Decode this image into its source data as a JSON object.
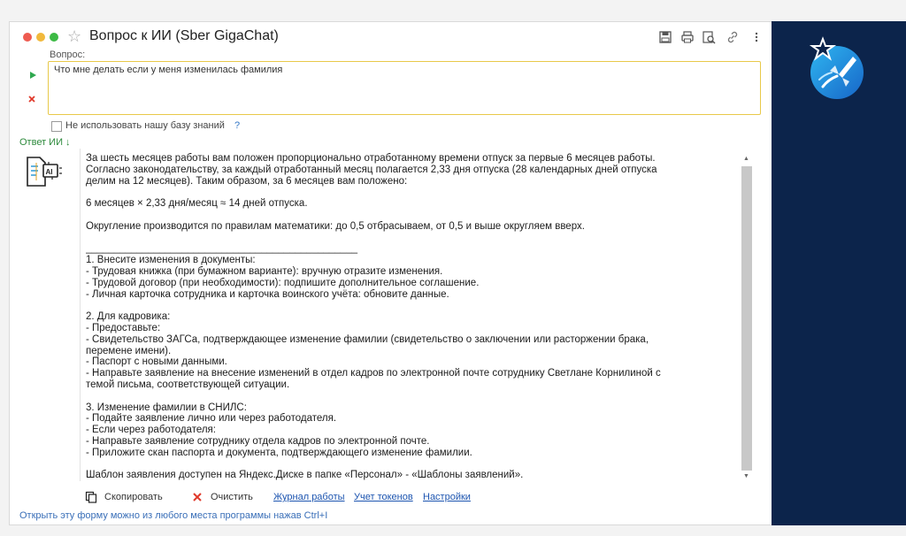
{
  "window": {
    "title": "Вопрос к ИИ (Sber GigaChat)"
  },
  "question": {
    "label": "Вопрос:",
    "value": "Что мне делать если у меня изменилась фамилия"
  },
  "knowledge_base": {
    "label": "Не использовать нашу базу знаний",
    "help": "?"
  },
  "answer": {
    "label": "Ответ ИИ ↓",
    "text": "За шесть месяцев работы вам положен пропорционально отработанному времени отпуск за первые 6 месяцев работы.\nСогласно законодательству, за каждый отработанный месяц полагается 2,33 дня отпуска (28 календарных дней отпуска\nделим на 12 месяцев). Таким образом, за 6 месяцев вам положено:\n\n6 месяцев × 2,33 дня/месяц ≈ 14 дней отпуска.\n\nОкругление производится по правилам математики: до 0,5 отбрасываем, от 0,5 и выше округляем вверх.\n\n________________________________________________\n1. Внесите изменения в документы:\n- Трудовая книжка (при бумажном варианте): вручную отразите изменения.\n- Трудовой договор (при необходимости): подпишите дополнительное соглашение.\n- Личная карточка сотрудника и карточка воинского учёта: обновите данные.\n\n2. Для кадровика:\n- Предоставьте:\n- Свидетельство ЗАГСа, подтверждающее изменение фамилии (свидетельство о заключении или расторжении брака,\nперемене имени).\n- Паспорт с новыми данными.\n- Направьте заявление на внесение изменений в отдел кадров по электронной почте сотруднику Светлане Корнилиной с\nтемой письма, соответствующей ситуации.\n\n3. Изменение фамилии в СНИЛС:\n- Подайте заявление лично или через работодателя.\n- Если через работодателя:\n- Направьте заявление сотруднику отдела кадров по электронной почте.\n- Приложите скан паспорта и документа, подтверждающего изменение фамилии.\n\nШаблон заявления доступен на Яндекс.Диске в папке «Персонал» - «Шаблоны заявлений»."
  },
  "actions": {
    "copy": "Скопировать",
    "clear": "Очистить",
    "journal": "Журнал работы",
    "tokens": "Учет токенов",
    "settings": "Настройки"
  },
  "footer": "Открыть эту форму можно из любого места программы нажав Ctrl+I",
  "colors": {
    "side_panel": "#0c244b",
    "accent_green": "#2d8a3c",
    "link_blue": "#1d55b0",
    "input_border": "#e8c94a"
  }
}
